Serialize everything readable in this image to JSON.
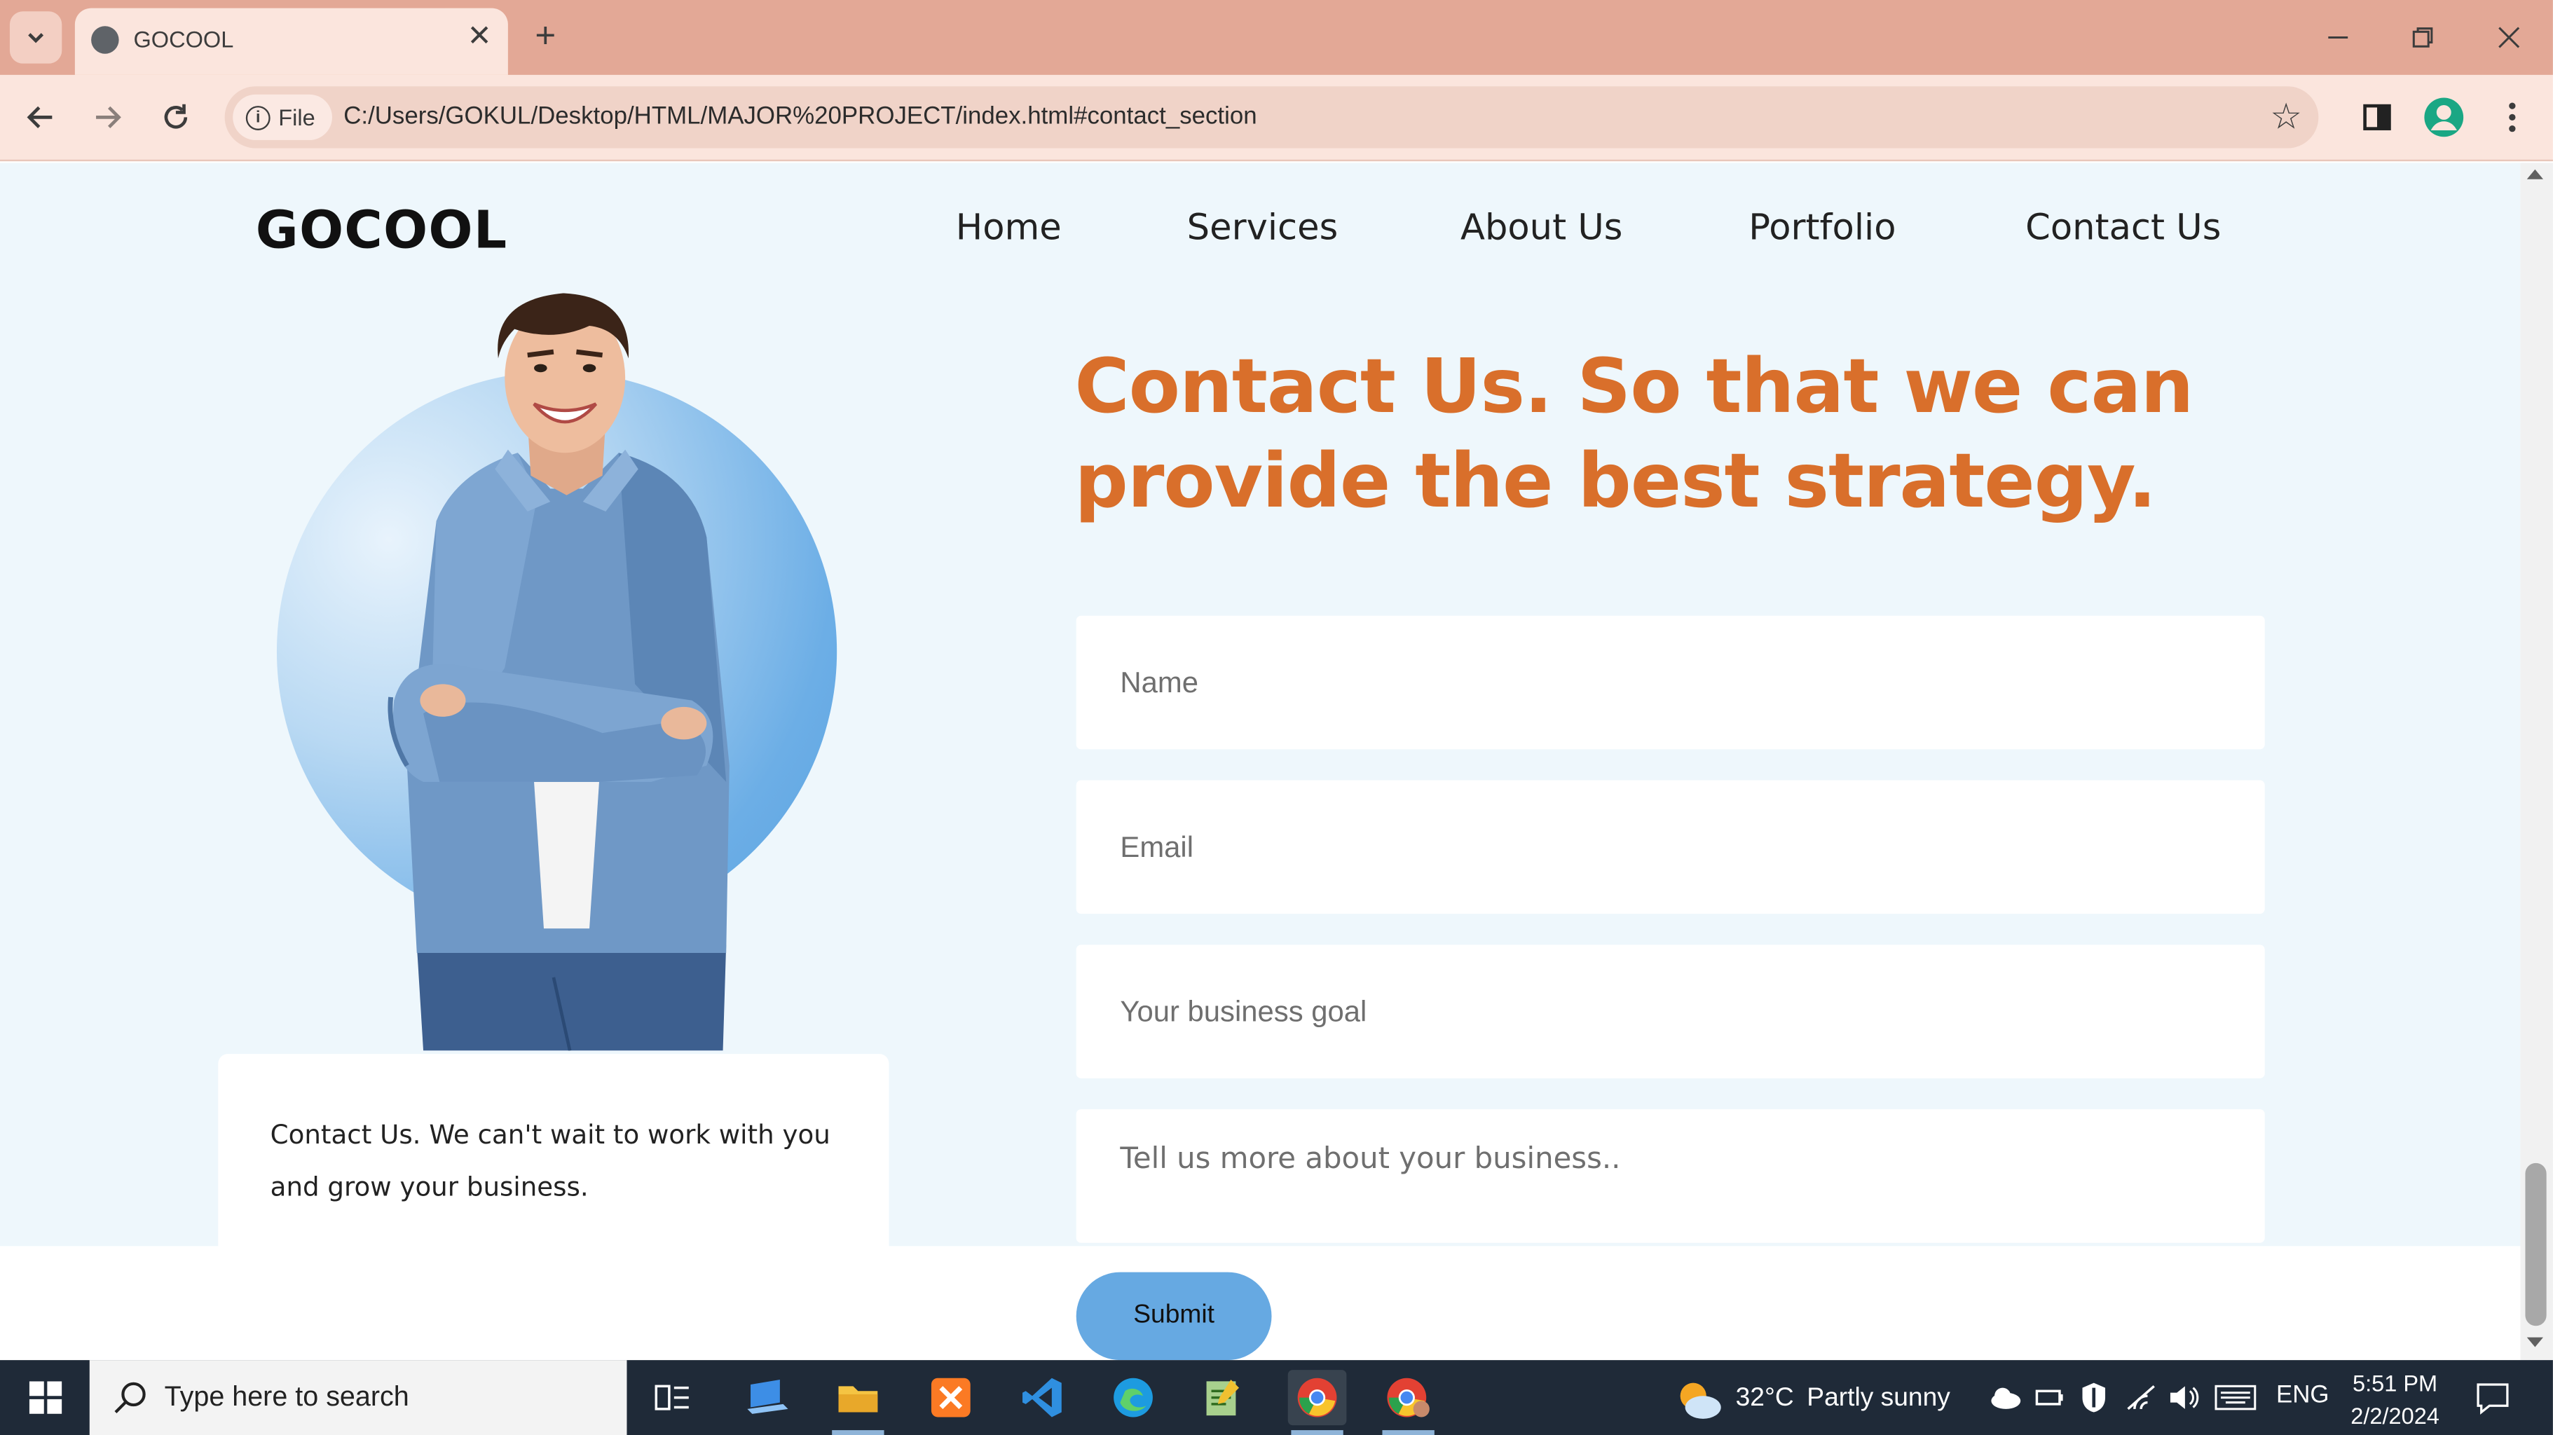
{
  "browser": {
    "tab_title": "GOCOOL",
    "new_tab_label": "+",
    "file_chip_label": "File",
    "url": "C:/Users/GOKUL/Desktop/HTML/MAJOR%20PROJECT/index.html#contact_section"
  },
  "site": {
    "logo": "GOCOOL",
    "nav": [
      "Home",
      "Services",
      "About Us",
      "Portfolio",
      "Contact Us"
    ]
  },
  "contact": {
    "headline": "Contact Us. So that we can provide the best strategy.",
    "caption": "Contact Us. We can't wait to work with you and grow your business.",
    "fields": {
      "name_placeholder": "Name",
      "email_placeholder": "Email",
      "goal_placeholder": "Your business goal",
      "message_placeholder": "Tell us more about your business.."
    },
    "submit_label": "Submit"
  },
  "taskbar": {
    "search_placeholder": "Type here to search",
    "temperature": "32°C",
    "weather_text": "Partly sunny",
    "language": "ENG",
    "time": "5:51 PM",
    "date": "2/2/2024"
  },
  "colors": {
    "accent_orange": "#d96f2b",
    "button_blue": "#66a9e2",
    "section_bg": "#eef7fc",
    "tab_bar": "#e3a896"
  }
}
